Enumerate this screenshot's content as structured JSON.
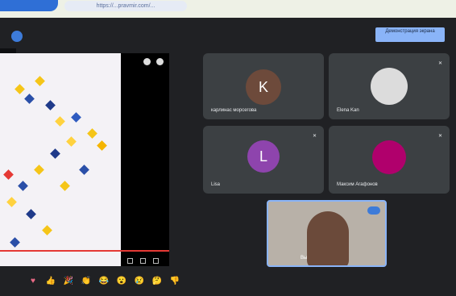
{
  "browser": {
    "active_tab_label": "",
    "link_text": "https://...pravmir.com/..."
  },
  "header": {
    "present_button_label": "Демонстрация экрана"
  },
  "participants": [
    {
      "name": "карлинас морсегова",
      "avatar_letter": "K",
      "avatar_color": "#6d4a3b"
    },
    {
      "name": "Elena Kan",
      "avatar_letter": "",
      "avatar_color": "#dcdcdc"
    },
    {
      "name": "Lisa",
      "avatar_letter": "L",
      "avatar_color": "#8e44ad"
    },
    {
      "name": "Максим Агафонов",
      "avatar_letter": "",
      "avatar_color": "#b0006c"
    }
  ],
  "self_view": {
    "name": "Вы"
  },
  "reactions": [
    "♥",
    "👍",
    "🎉",
    "👏",
    "😂",
    "😮",
    "😢",
    "🤔",
    "👎"
  ],
  "colors": {
    "accent": "#8ab4f8",
    "background": "#202124",
    "tile": "#3c4043"
  }
}
